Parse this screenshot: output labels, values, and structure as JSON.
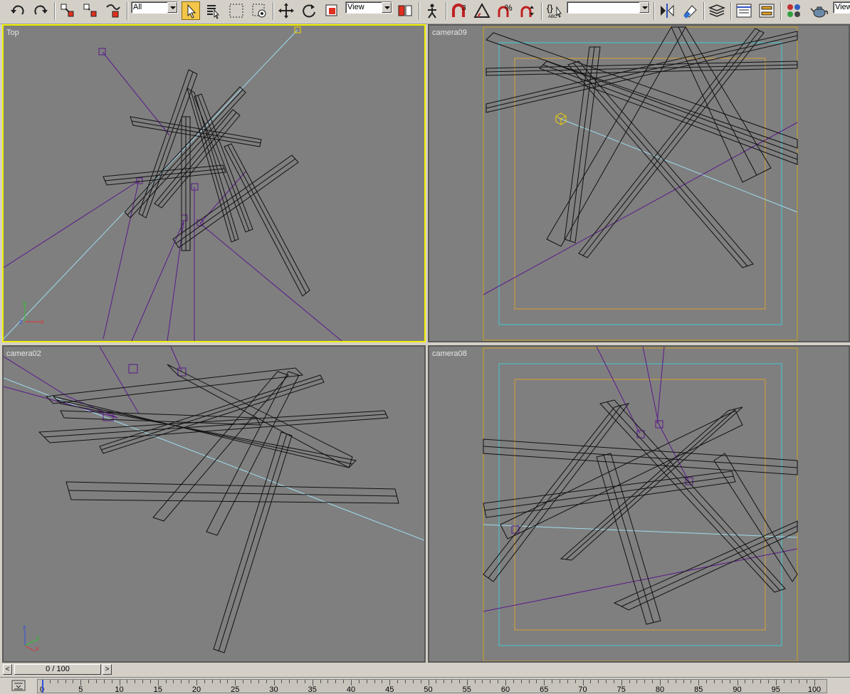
{
  "toolbar": {
    "selection_filter": "All",
    "coord_system": "View",
    "named_selection": "",
    "right_combo": "View",
    "icons": [
      "undo-icon",
      "redo-icon",
      "select-and-link-icon",
      "unlink-icon",
      "bind-spacewarp-icon",
      "select-object-icon",
      "select-by-name-icon",
      "rectangular-selection-icon",
      "window-crossing-icon",
      "select-and-move-icon",
      "select-and-rotate-icon",
      "select-and-scale-icon",
      "pivot-center-icon",
      "select-and-manipulate-icon",
      "snap-3d-icon",
      "angle-snap-icon",
      "percent-snap-icon",
      "spinner-snap-icon",
      "edit-named-selection-icon",
      "mirror-icon",
      "align-icon",
      "layer-manager-icon",
      "curve-editor-icon",
      "schematic-view-icon",
      "material-editor-icon",
      "render-teapot-icon"
    ]
  },
  "viewports": {
    "top_left": {
      "label": "Top",
      "axis": {
        "y": "y",
        "x": "x"
      }
    },
    "top_right": {
      "label": "camera09"
    },
    "bottom_left": {
      "label": "camera02",
      "axis": {
        "z": "z",
        "y": "y",
        "x": "x"
      }
    },
    "bottom_right": {
      "label": "camera08"
    }
  },
  "colors": {
    "viewport_bg": "#7f7f7f",
    "active_border": "#f0f000",
    "camera": "#5a1a8a",
    "target_line": "#9fdcec",
    "safe_frame_outer": "#c8a020",
    "safe_frame_action": "#40c8d0",
    "safe_frame_title": "#d8a030",
    "wireframe": "#000000"
  },
  "timeline": {
    "slider_label": "0 / 100",
    "prev_label": "<",
    "next_label": ">",
    "ticks": [
      "0",
      "5",
      "10",
      "15",
      "20",
      "25",
      "30",
      "35",
      "40",
      "45",
      "50",
      "55",
      "60",
      "65",
      "70",
      "75",
      "80",
      "85",
      "90",
      "95",
      "100"
    ]
  }
}
